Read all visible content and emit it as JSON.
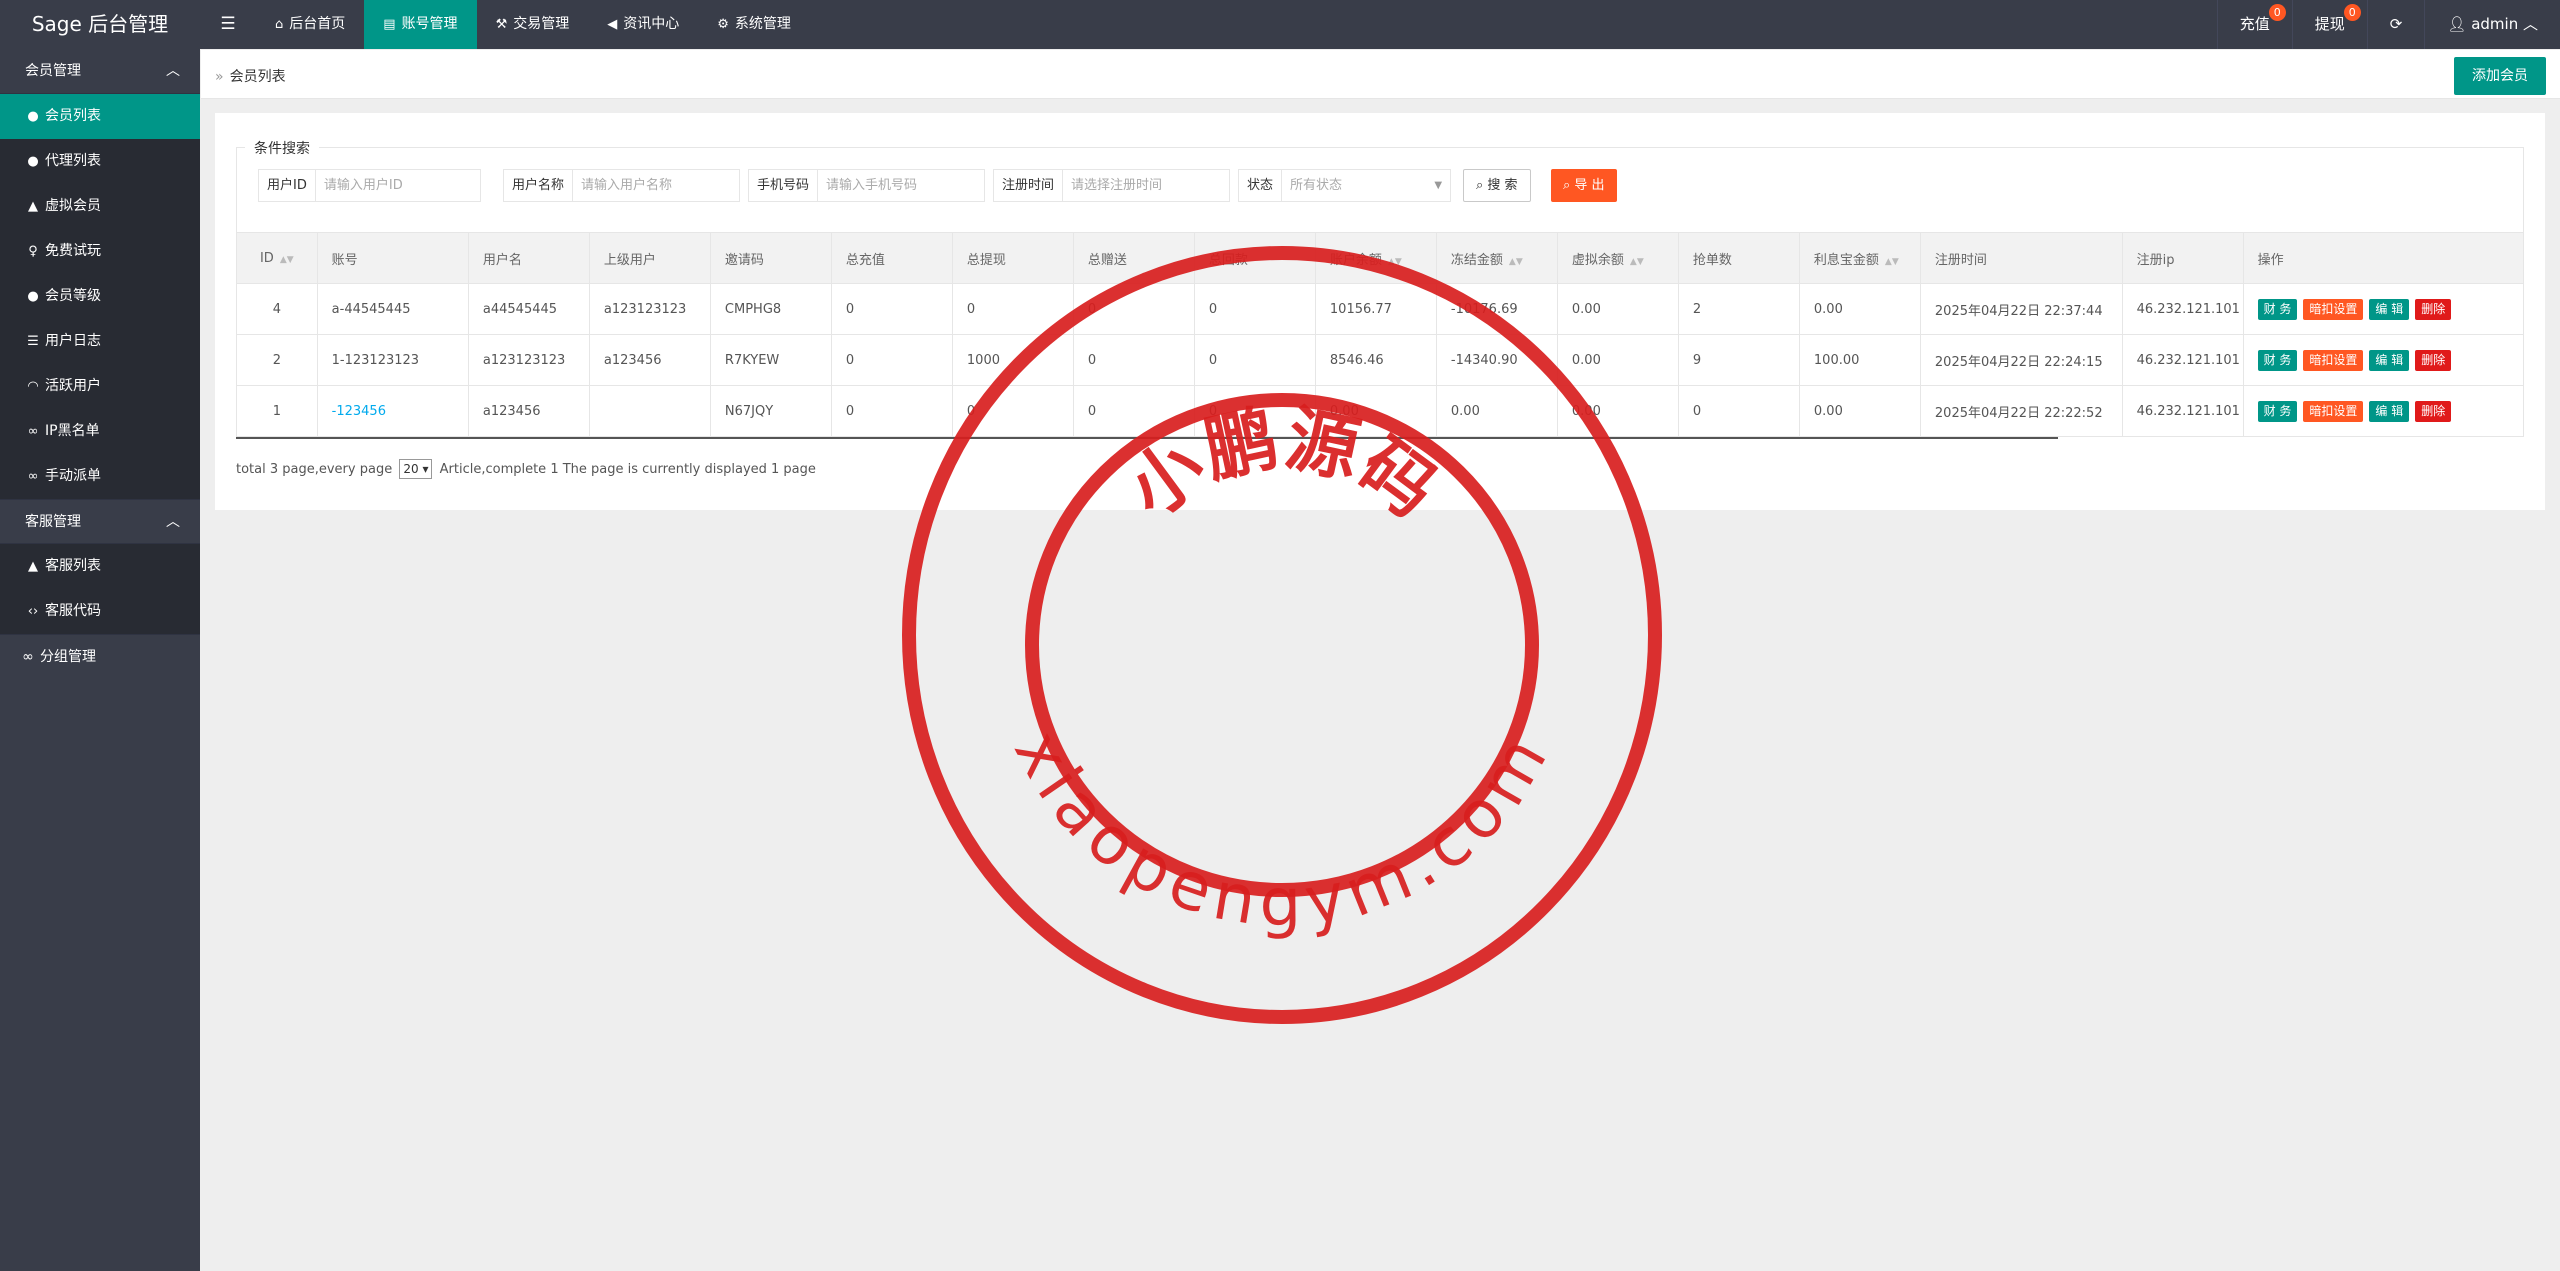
{
  "app": {
    "title": "Sage 后台管理"
  },
  "header": {
    "toggle_icon": "menu-icon",
    "nav": [
      {
        "label": "后台首页",
        "icon": "home-icon",
        "active": false
      },
      {
        "label": "账号管理",
        "icon": "id-card-icon",
        "active": true
      },
      {
        "label": "交易管理",
        "icon": "gavel-icon",
        "active": false
      },
      {
        "label": "资讯中心",
        "icon": "bullhorn-icon",
        "active": false
      },
      {
        "label": "系统管理",
        "icon": "gears-icon",
        "active": false
      }
    ],
    "right": {
      "recharge": {
        "label": "充值",
        "count": "0"
      },
      "withdraw": {
        "label": "提现",
        "count": "0"
      },
      "refresh_icon": "refresh-icon",
      "user": "admin"
    }
  },
  "sidebar": {
    "groups": [
      {
        "label": "会员管理",
        "items": [
          {
            "label": "会员列表",
            "icon": "user-icon",
            "active": true
          },
          {
            "label": "代理列表",
            "icon": "users-icon"
          },
          {
            "label": "虚拟会员",
            "icon": "user-secret-icon"
          },
          {
            "label": "免费试玩",
            "icon": "female-icon"
          },
          {
            "label": "会员等级",
            "icon": "group-icon"
          },
          {
            "label": "用户日志",
            "icon": "list-icon"
          },
          {
            "label": "活跃用户",
            "icon": "wifi-icon"
          },
          {
            "label": "IP黑名单",
            "icon": "link-icon"
          },
          {
            "label": "手动派单",
            "icon": "link-icon"
          }
        ]
      },
      {
        "label": "客服管理",
        "items": [
          {
            "label": "客服列表",
            "icon": "user-secret-icon"
          },
          {
            "label": "客服代码",
            "icon": "code-icon"
          }
        ]
      }
    ],
    "single": {
      "label": "分组管理",
      "icon": "link-icon"
    }
  },
  "breadcrumb": {
    "current": "会员列表"
  },
  "add_button": "添加会员",
  "search": {
    "legend": "条件搜索",
    "fields": {
      "user_id": {
        "label": "用户ID",
        "placeholder": "请输入用户ID",
        "value": ""
      },
      "username": {
        "label": "用户名称",
        "placeholder": "请输入用户名称",
        "value": ""
      },
      "phone": {
        "label": "手机号码",
        "placeholder": "请输入手机号码",
        "value": ""
      },
      "reg_time": {
        "label": "注册时间",
        "placeholder": "请选择注册时间",
        "value": ""
      },
      "status": {
        "label": "状态",
        "selected": "所有状态"
      }
    },
    "search_button": "搜 索",
    "export_button": "导 出"
  },
  "table": {
    "headers": [
      "ID",
      "账号",
      "用户名",
      "上级用户",
      "邀请码",
      "总充值",
      "总提现",
      "总赠送",
      "总回款",
      "账户余额",
      "冻结金额",
      "虚拟余额",
      "抢单数",
      "利息宝金额",
      "注册时间",
      "注册ip",
      "操作"
    ],
    "rows": [
      [
        "4",
        "a-44545445",
        "a44545445",
        "a123123123",
        "CMPHG8",
        "0",
        "0",
        "0",
        "0",
        "10156.77",
        "-10176.69",
        "0.00",
        "2",
        "0.00",
        "2025年04月22日 22:37:44",
        "46.232.121.101"
      ],
      [
        "2",
        "1-123123123",
        "a123123123",
        "a123456",
        "R7KYEW",
        "0",
        "1000",
        "0",
        "0",
        "8546.46",
        "-14340.90",
        "0.00",
        "9",
        "100.00",
        "2025年04月22日 22:24:15",
        "46.232.121.101"
      ],
      [
        "1",
        "-123456",
        "a123456",
        "",
        "N67JQY",
        "0",
        "0",
        "0",
        "0",
        "0.00",
        "0.00",
        "0.00",
        "0",
        "0.00",
        "2025年04月22日 22:22:52",
        "46.232.121.101"
      ]
    ],
    "actions": [
      "财 务",
      "暗扣设置",
      "编 辑",
      "删除"
    ]
  },
  "pager": {
    "prefix": "total 3 page,every page",
    "per_page": "20",
    "suffix": "Article,complete 1 The page is currently displayed 1 page"
  },
  "watermark": {
    "top_text": "小鹏源码",
    "bottom_text": "xiaopengym.com",
    "color": "#d81e1e"
  }
}
